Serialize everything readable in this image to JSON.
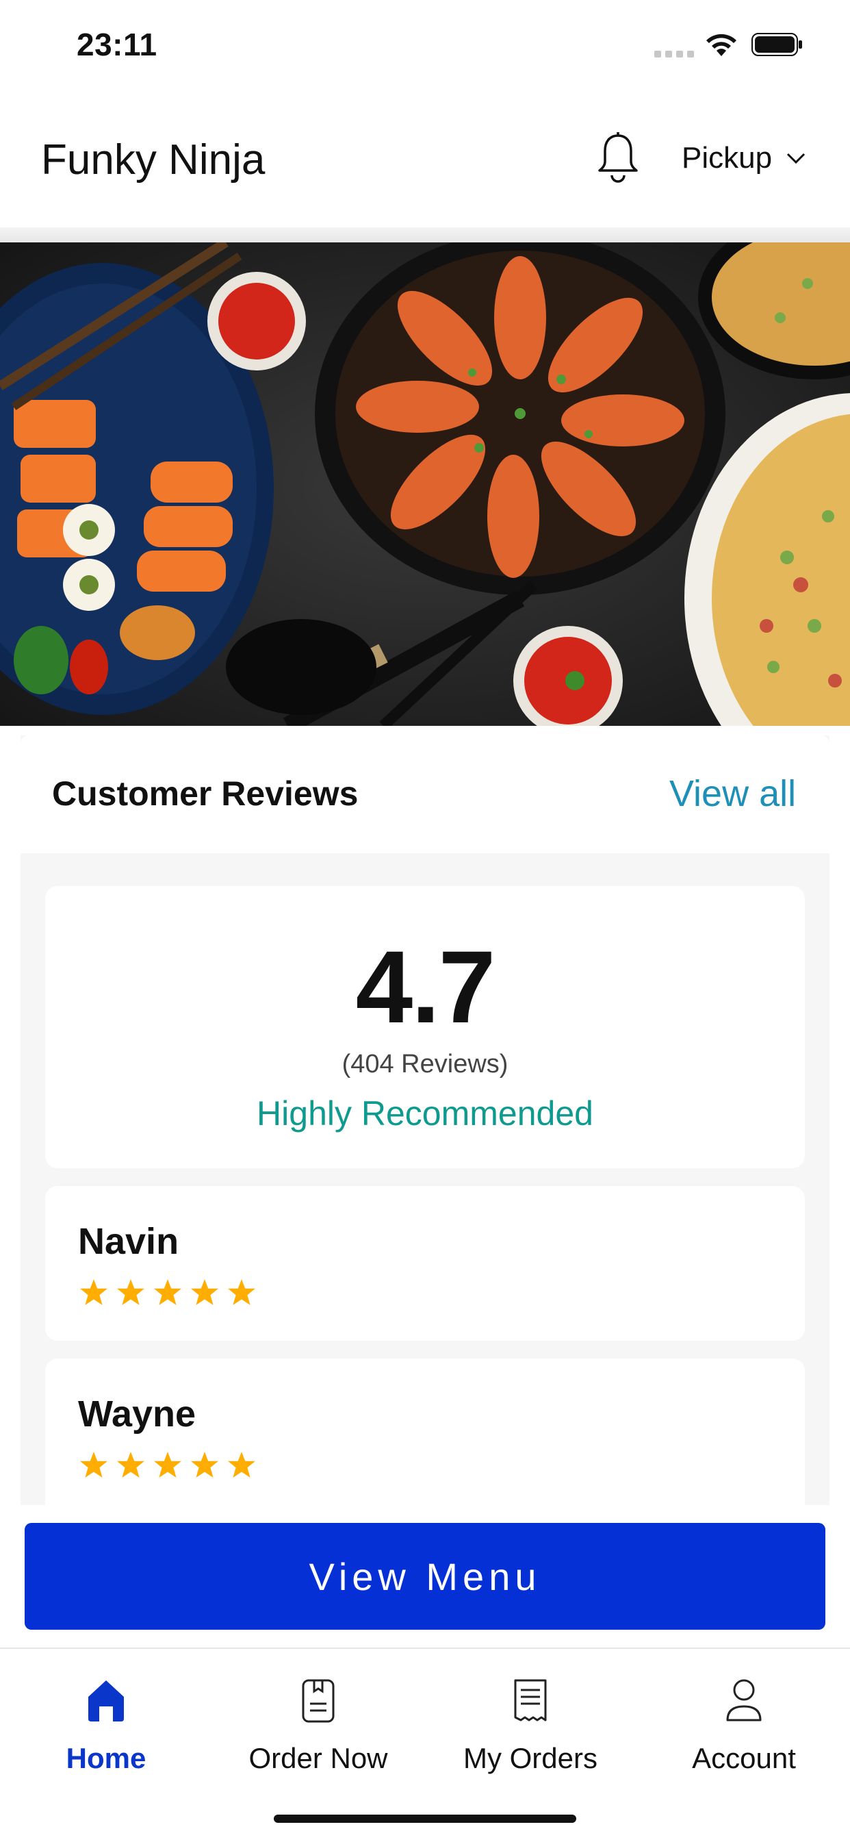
{
  "status_bar": {
    "time": "23:11"
  },
  "header": {
    "title": "Funky Ninja",
    "mode": "Pickup"
  },
  "reviews": {
    "title": "Customer Reviews",
    "view_all": "View all",
    "summary": {
      "rating": "4.7",
      "count": "(404 Reviews)",
      "label": "Highly Recommended"
    },
    "items": [
      {
        "name": "Navin",
        "stars": 5
      },
      {
        "name": "Wayne",
        "stars": 5
      }
    ]
  },
  "cta": {
    "label": "View Menu"
  },
  "tabs": [
    {
      "label": "Home",
      "icon": "home-icon",
      "active": true
    },
    {
      "label": "Order Now",
      "icon": "order-icon",
      "active": false
    },
    {
      "label": "My Orders",
      "icon": "receipt-icon",
      "active": false
    },
    {
      "label": "Account",
      "icon": "account-icon",
      "active": false
    }
  ],
  "colors": {
    "accent": "#0530d6",
    "link": "#1e90b8",
    "recommend": "#0f9a8f",
    "star": "#ffad00"
  }
}
